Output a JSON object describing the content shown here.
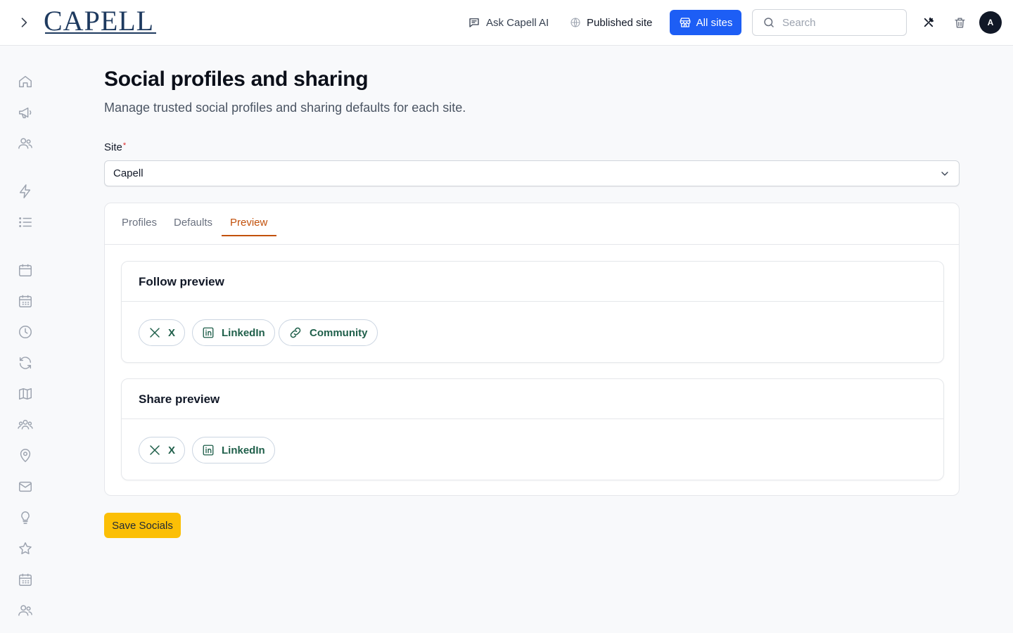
{
  "header": {
    "logo_text": "CAPELL",
    "ask_ai_label": "Ask Capell AI",
    "published_site_label": "Published site",
    "all_sites_label": "All sites",
    "search_placeholder": "Search",
    "avatar_initial": "A",
    "icons": [
      "chevron-right-icon",
      "chat-icon",
      "globe-icon",
      "store-icon",
      "search-icon",
      "tools-icon",
      "trash-icon"
    ]
  },
  "sidebar": {
    "icons": [
      "home-icon",
      "megaphone-icon",
      "users-icon",
      "lightning-icon",
      "list-icon",
      "calendar-icon",
      "calendar-grid-icon",
      "clock-icon",
      "refresh-icon",
      "map-icon",
      "team-icon",
      "location-pin-icon",
      "mail-icon",
      "lightbulb-icon",
      "star-icon",
      "calendar-grid-icon",
      "users-icon"
    ]
  },
  "page": {
    "title": "Social profiles and sharing",
    "subtitle": "Manage trusted social profiles and sharing defaults for each site."
  },
  "site_field": {
    "label": "Site",
    "required_marker": "*",
    "selected_value": "Capell"
  },
  "tabs": [
    {
      "label": "Profiles",
      "active": false
    },
    {
      "label": "Defaults",
      "active": false
    },
    {
      "label": "Preview",
      "active": true
    }
  ],
  "follow_preview": {
    "title": "Follow preview",
    "chips": [
      {
        "label": "X",
        "icon": "x-icon"
      },
      {
        "label": "LinkedIn",
        "icon": "linkedin-icon"
      },
      {
        "label": "Community",
        "icon": "link-icon"
      }
    ]
  },
  "share_preview": {
    "title": "Share preview",
    "chips": [
      {
        "label": "X",
        "icon": "x-icon"
      },
      {
        "label": "LinkedIn",
        "icon": "linkedin-icon"
      }
    ]
  },
  "save_button_label": "Save Socials",
  "colors": {
    "primary_blue": "#1d5ef5",
    "active_tab": "#c2510c",
    "chip_text": "#1f5f4a",
    "save_button": "#fbbf06"
  }
}
